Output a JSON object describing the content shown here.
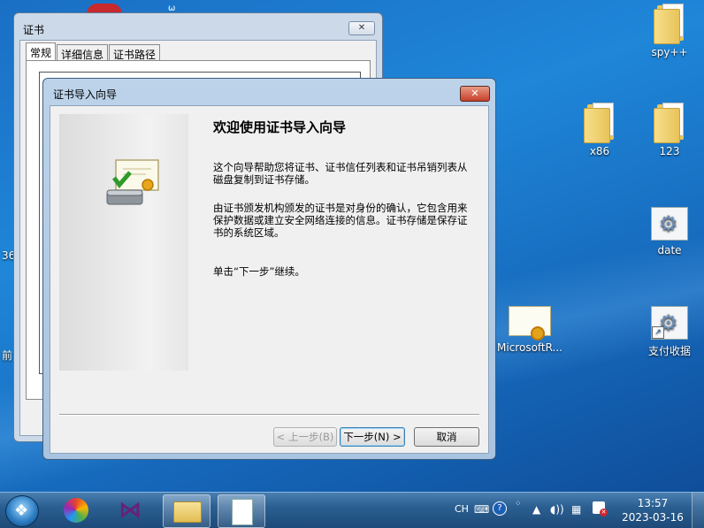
{
  "desktop": {
    "icons": [
      {
        "label": "spy++",
        "type": "folder"
      },
      {
        "label": "x86",
        "type": "folder"
      },
      {
        "label": "123",
        "type": "folder"
      },
      {
        "label": "date",
        "type": "gear-file"
      },
      {
        "label": "MicrosoftR...",
        "type": "certificate-file"
      },
      {
        "label": "支付收据",
        "type": "gear-file-shortcut"
      }
    ],
    "edge_text_left_1": "36",
    "edge_text_left_2": "前"
  },
  "cert_window": {
    "title": "证书",
    "close_glyph": "✕",
    "tabs": [
      "常规",
      "详细信息",
      "证书路径"
    ],
    "partial_text": "T"
  },
  "wizard": {
    "title": "证书导入向导",
    "close_glyph": "✕",
    "heading": "欢迎使用证书导入向导",
    "para1": "这个向导帮助您将证书、证书信任列表和证书吊销列表从磁盘复制到证书存储。",
    "para2": "由证书颁发机构颁发的证书是对身份的确认，它包含用来保护数据或建立安全网络连接的信息。证书存储是保存证书的系统区域。",
    "para3": "单击“下一步”继续。",
    "buttons": {
      "back": "< 上一步(B)",
      "next": "下一步(N) >",
      "cancel": "取消"
    }
  },
  "taskbar": {
    "tray": {
      "ime": "CH",
      "clock_time": "13:57",
      "clock_date": "2023-03-16"
    }
  },
  "colors": {
    "desktop": "#1f86d8",
    "wizard_frame": "#a9c4e0",
    "close_button": "#c7402a"
  }
}
